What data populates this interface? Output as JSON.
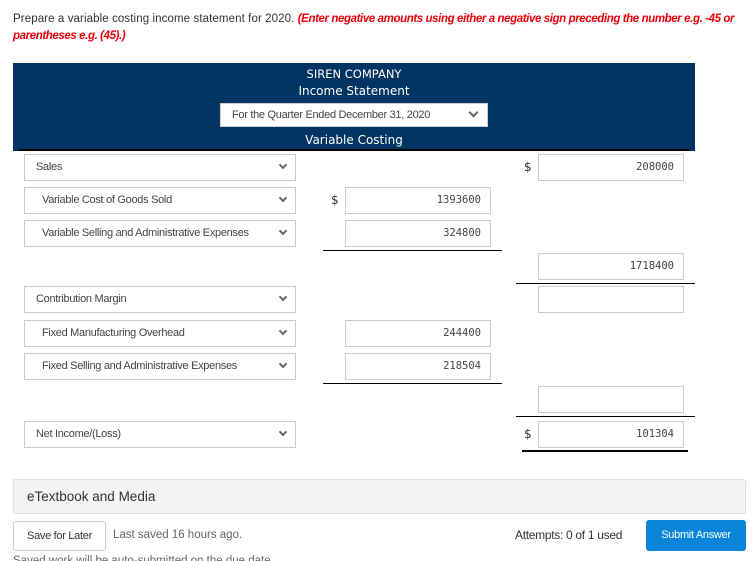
{
  "instructions": {
    "text": "Prepare a variable costing income statement for 2020.",
    "hint": "(Enter negative amounts using either a negative sign preceding the number e.g. -45 or parentheses e.g. (45).)"
  },
  "statement": {
    "company": "SIREN COMPANY",
    "title": "Income Statement",
    "period_selected": "For the Quarter Ended December 31, 2020",
    "subtitle": "Variable Costing"
  },
  "rows": [
    {
      "label": "Sales",
      "column": "right",
      "value": "208000",
      "currency": "$"
    },
    {
      "label": "Variable Cost of Goods Sold",
      "column": "mid",
      "value": "1393600",
      "currency": "$"
    },
    {
      "label": "Variable Selling and Administrative Expenses",
      "column": "mid",
      "value": "324800",
      "currency": ""
    },
    {
      "label": "",
      "column": "right",
      "value": "1718400",
      "currency": ""
    },
    {
      "label": "Contribution Margin",
      "column": "right",
      "value": "",
      "currency": ""
    },
    {
      "label": "Fixed Manufacturing Overhead",
      "column": "mid",
      "value": "244400",
      "currency": ""
    },
    {
      "label": "Fixed Selling and Administrative Expenses",
      "column": "mid",
      "value": "218504",
      "currency": ""
    },
    {
      "label": "",
      "column": "right",
      "value": "",
      "currency": ""
    },
    {
      "label": "Net Income/(Loss)",
      "column": "right",
      "value": "101304",
      "currency": "$"
    }
  ],
  "footer": {
    "etextbook": "eTextbook and Media",
    "save_label": "Save for Later",
    "last_saved": "Last saved 16 hours ago.",
    "auto_note": "Saved work will be auto-submitted on the due date.",
    "attempts": "Attempts: 0 of 1 used",
    "submit_label": "Submit Answer"
  },
  "colors": {
    "header_bg": "#003462",
    "hint_red": "#e8000b",
    "submit_blue": "#0a85d9"
  }
}
